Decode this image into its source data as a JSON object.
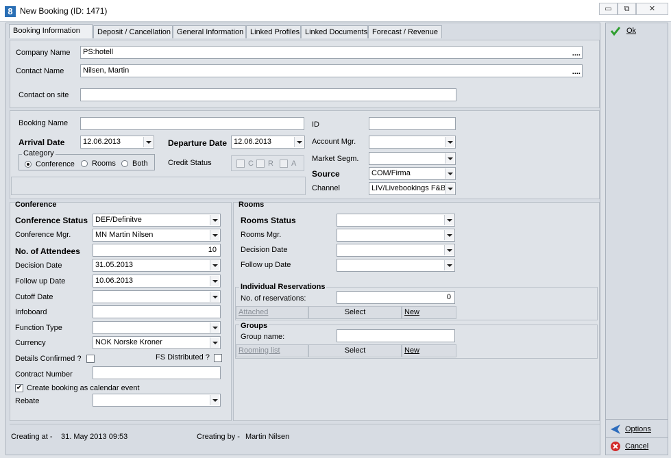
{
  "window": {
    "title": "New Booking (ID: 1471)",
    "minimize": "▭",
    "restore": "⧉",
    "close": "✕",
    "icon_text": "8"
  },
  "tabs": [
    "Booking Information",
    "Deposit / Cancellation",
    "General Information",
    "Linked Profiles",
    "Linked Documents",
    "Forecast / Revenue"
  ],
  "company": {
    "company_label": "Company Name",
    "company_value": "PS:hotell",
    "contact_label": "Contact Name",
    "contact_value": "Nilsen, Martin",
    "onsite_label": "Contact on site",
    "onsite_value": "",
    "more": "...."
  },
  "booking": {
    "booking_name_label": "Booking Name",
    "booking_name_value": "",
    "arrival_label": "Arrival Date",
    "arrival_value": "12.06.2013",
    "departure_label": "Departure Date",
    "departure_value": "12.06.2013",
    "category_label": "Category",
    "category_options": [
      "Conference",
      "Rooms",
      "Both"
    ],
    "category_selected": "Conference",
    "credit_status_label": "Credit Status",
    "credit_options": [
      "C",
      "R",
      "A"
    ],
    "id_label": "ID",
    "id_value": "",
    "account_mgr_label": "Account Mgr.",
    "account_mgr_value": "",
    "market_segm_label": "Market Segm.",
    "market_segm_value": "",
    "source_label": "Source",
    "source_value": "COM/Firma",
    "channel_label": "Channel",
    "channel_value": "LIV/Livebookings F&B"
  },
  "conference": {
    "title": "Conference",
    "status_label": "Conference Status",
    "status_value": "DEF/Definitve",
    "mgr_label": "Conference Mgr.",
    "mgr_value": "MN Martin Nilsen",
    "attendees_label": "No. of Attendees",
    "attendees_value": "10",
    "decision_label": "Decision Date",
    "decision_value": "31.05.2013",
    "followup_label": "Follow up Date",
    "followup_value": "10.06.2013",
    "cutoff_label": "Cutoff Date",
    "cutoff_value": "",
    "infoboard_label": "Infoboard",
    "infoboard_value": "",
    "function_label": "Function Type",
    "function_value": "",
    "currency_label": "Currency",
    "currency_value": "NOK Norske Kroner",
    "details_confirmed_label": "Details Confirmed ?",
    "fs_distributed_label": "FS Distributed ?",
    "contract_label": "Contract Number",
    "contract_value": "",
    "calendar_label": "Create booking as calendar event",
    "calendar_checked": "✔",
    "rebate_label": "Rebate",
    "rebate_value": ""
  },
  "rooms": {
    "title": "Rooms",
    "status_label": "Rooms Status",
    "status_value": "",
    "mgr_label": "Rooms Mgr.",
    "mgr_value": "",
    "decision_label": "Decision Date",
    "decision_value": "",
    "followup_label": "Follow up Date",
    "followup_value": "",
    "individual_title": "Individual Reservations",
    "num_res_label": "No. of reservations:",
    "num_res_value": "0",
    "attached_label": "Attached",
    "select_label": "Select",
    "new_label": "New",
    "groups_title": "Groups",
    "group_name_label": "Group name:",
    "group_name_value": "",
    "rooming_label": "Rooming list",
    "select2_label": "Select",
    "new2_label": "New"
  },
  "footer": {
    "creating_at_label": "Creating at -",
    "creating_at_value": "31. May 2013 09:53",
    "creating_by_label": "Creating by -",
    "creating_by_value": "Martin Nilsen"
  },
  "sidebar": {
    "ok_label": "Ok",
    "options_label": "Options",
    "cancel_label": "Cancel"
  }
}
